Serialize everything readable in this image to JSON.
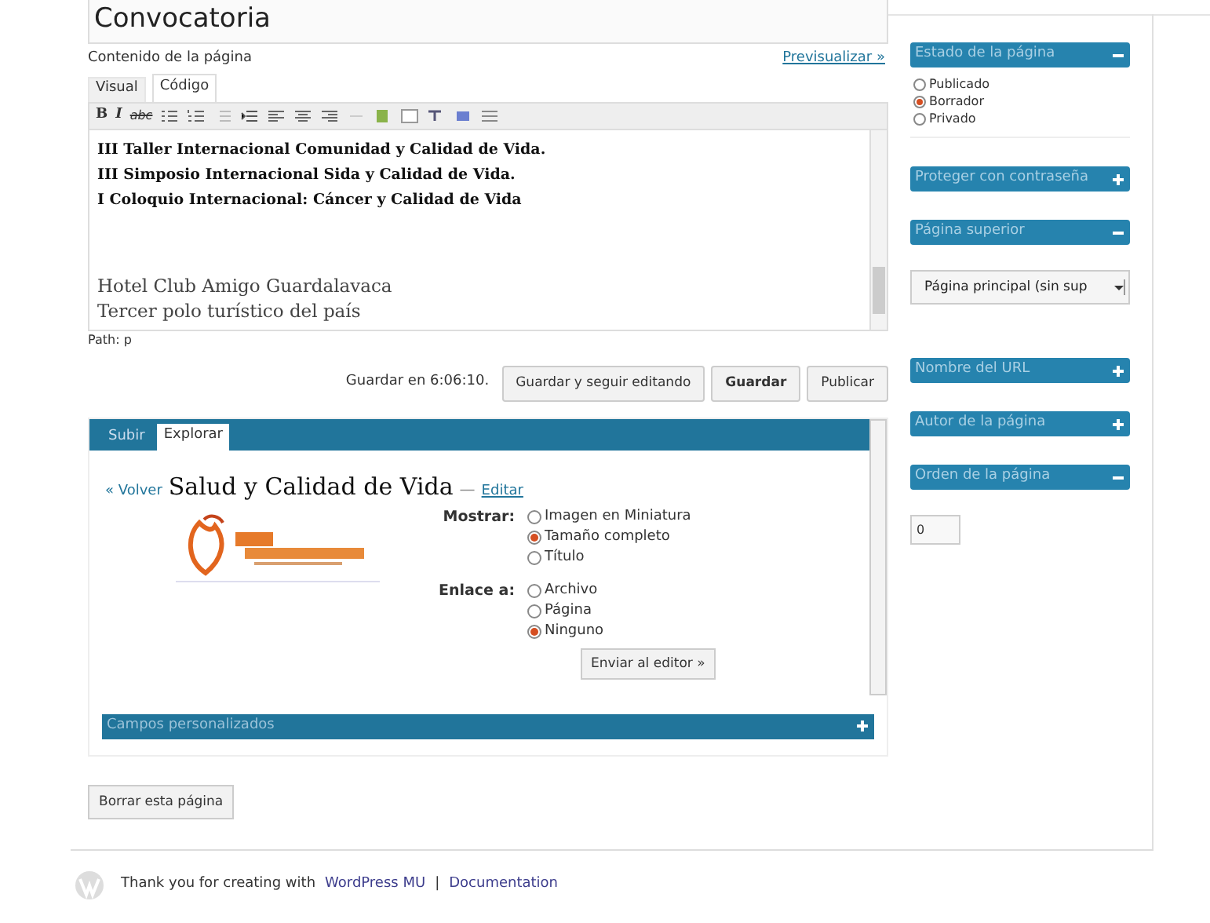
{
  "title_field": {
    "value": "Convocatoria"
  },
  "editor": {
    "label": "Contenido de la página",
    "preview_link": "Previsualizar »",
    "tabs": [
      {
        "label": "Visual",
        "selected": false
      },
      {
        "label": "Código",
        "selected": true
      }
    ],
    "format_buttons": [
      "B",
      "I",
      "abc"
    ],
    "content": [
      {
        "kind": "heading",
        "text": "III Taller Internacional  Comunidad y Calidad de Vida."
      },
      {
        "kind": "heading",
        "text": "III Simposio Internacional  Sida y Calidad de Vida."
      },
      {
        "kind": "heading",
        "text": "I Coloquio Internacional: Cáncer y Calidad de Vida"
      },
      {
        "kind": "gap"
      },
      {
        "kind": "plain",
        "text": "Hotel Club Amigo Guardalavaca"
      },
      {
        "kind": "plain",
        "text": "Tercer polo turístico del país"
      }
    ],
    "path": "Path: p"
  },
  "save_row": {
    "status": "Guardar en 6:06:10.",
    "buttons": [
      {
        "label": "Guardar y seguir editando",
        "kind": "normal"
      },
      {
        "label": "Guardar",
        "kind": "bold"
      },
      {
        "label": "Publicar",
        "kind": "normal"
      }
    ]
  },
  "media_panel": {
    "tabs": [
      {
        "label": "Subir",
        "selected": false
      },
      {
        "label": "Explorar",
        "selected": true
      }
    ],
    "back_link": "« Volver",
    "title": "Salud y Calidad de Vida",
    "dash": "—",
    "edit_link": "Editar",
    "groups": [
      {
        "label": "Mostrar:",
        "options": [
          {
            "label": "Imagen en Miniatura",
            "selected": false
          },
          {
            "label": "Tamaño completo",
            "selected": true
          },
          {
            "label": "Título",
            "selected": false
          }
        ]
      },
      {
        "label": "Enlace a:",
        "options": [
          {
            "label": "Archivo",
            "selected": false
          },
          {
            "label": "Página",
            "selected": false
          },
          {
            "label": "Ninguno",
            "selected": true
          }
        ]
      }
    ],
    "send_button": "Enviar al editor »"
  },
  "custom_fields": {
    "title": "Campos personalizados",
    "expanded": false
  },
  "delete_button": "Borrar esta página",
  "sidebar": [
    {
      "title": "Estado de la página",
      "expanded": true,
      "kind": "radios",
      "options": [
        {
          "label": "Publicado",
          "selected": false
        },
        {
          "label": "Borrador",
          "selected": true
        },
        {
          "label": "Privado",
          "selected": false
        }
      ]
    },
    {
      "title": "Proteger con contraseña",
      "expanded": false,
      "kind": "none"
    },
    {
      "title": "Página superior",
      "expanded": true,
      "kind": "select",
      "value": "Página principal (sin sup"
    },
    {
      "title": "Nombre del URL",
      "expanded": false,
      "kind": "none"
    },
    {
      "title": "Autor de la página",
      "expanded": false,
      "kind": "none"
    },
    {
      "title": "Orden de la página",
      "expanded": true,
      "kind": "input",
      "value": "0"
    }
  ],
  "footer": {
    "text": "Thank you for creating with",
    "link": "WordPress MU",
    "separator": "|",
    "doc_link": "Documentation"
  }
}
